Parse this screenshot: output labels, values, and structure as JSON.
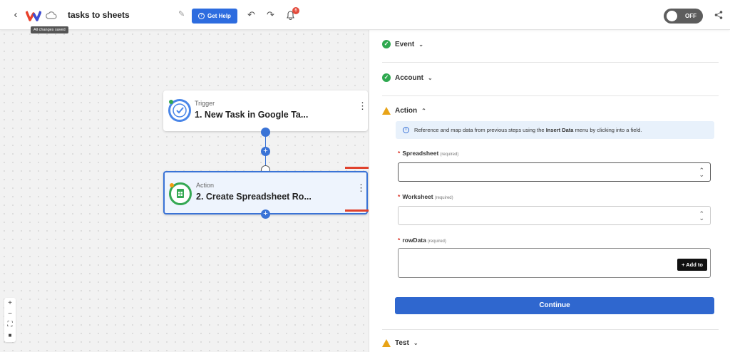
{
  "topbar": {
    "title": "tasks to sheets",
    "saved_tooltip": "All changes saved",
    "help_label": "Get Help",
    "notification_count": "6",
    "toggle_label": "OFF"
  },
  "canvas": {
    "trigger": {
      "kind": "Trigger",
      "name": "1. New Task in Google Ta..."
    },
    "action": {
      "kind": "Action",
      "name": "2. Create Spreadsheet Ro..."
    }
  },
  "panel": {
    "event_label": "Event",
    "account_label": "Account",
    "action_label": "Action",
    "info_text_prefix": "Reference and map data from previous steps using the ",
    "info_text_bold": "Insert Data",
    "info_text_suffix": " menu by clicking into a field.",
    "fields": {
      "spreadsheet": {
        "label": "Spreadsheet",
        "required": "(required)",
        "value": ""
      },
      "worksheet": {
        "label": "Worksheet",
        "required": "(required)",
        "value": ""
      },
      "rowdata": {
        "label": "rowData",
        "required": "(required)",
        "add_label": "+ Add to"
      }
    },
    "continue_label": "Continue",
    "test_label": "Test"
  },
  "colors": {
    "primary": "#2f67cf",
    "success": "#2ea84f",
    "warning": "#e8a317",
    "annotation_arrow": "#e0412c"
  }
}
